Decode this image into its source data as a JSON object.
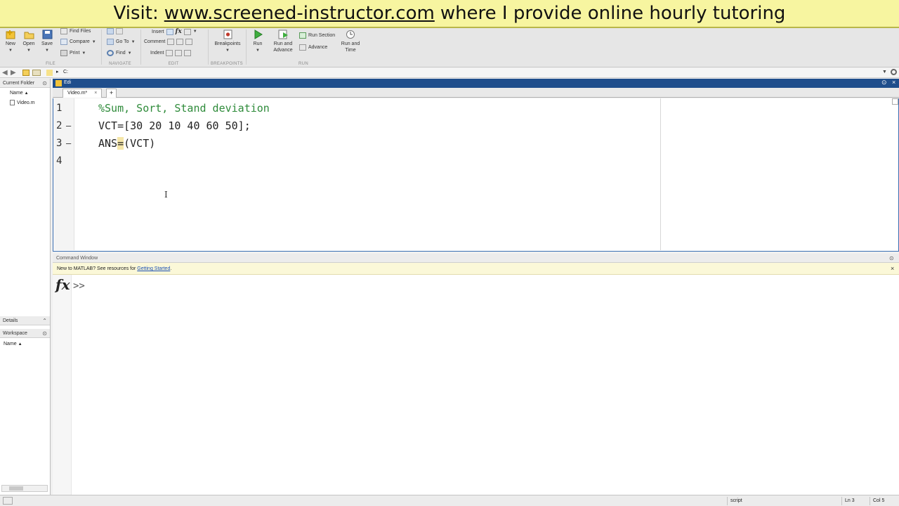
{
  "banner": {
    "prefix": "Visit:",
    "link": "www.screened-instructor.com",
    "suffix": "where I provide online hourly tutoring"
  },
  "toolstrip": {
    "file": {
      "new": "New",
      "open": "Open",
      "save": "Save",
      "find_files": "Find Files",
      "compare": "Compare",
      "print": "Print",
      "label": "FILE"
    },
    "navigate": {
      "go_to": "Go To",
      "find": "Find",
      "label": "NAVIGATE"
    },
    "edit": {
      "insert": "Insert",
      "comment": "Comment",
      "indent": "Indent",
      "fx": "fx",
      "label": "EDIT"
    },
    "breakpoints": {
      "breakpoints": "Breakpoints",
      "label": "BREAKPOINTS"
    },
    "run": {
      "run": "Run",
      "run_and_advance": "Run and Advance",
      "run_section": "Run Section",
      "advance": "Advance",
      "run_and_time": "Run and Time",
      "label": "RUN"
    }
  },
  "address": {
    "path": "C:"
  },
  "left": {
    "current_folder": "Current Folder",
    "name_col": "Name",
    "files": [
      "Video.m"
    ],
    "details": "Details",
    "workspace": "Workspace",
    "ws_name_col": "Name"
  },
  "editor": {
    "title": "Edi",
    "tab": "Video.m*",
    "add_tab": "+",
    "lines": [
      {
        "num": "1",
        "dash": "",
        "text": "%Sum, Sort, Stand deviation",
        "comment": true
      },
      {
        "num": "2",
        "dash": "—",
        "text": "VCT=[30 20 10 40 60 50];",
        "comment": false
      },
      {
        "num": "3",
        "dash": "—",
        "text_before": "ANS",
        "text_hl": "=",
        "text_after": "(VCT)",
        "comment": false
      },
      {
        "num": "4",
        "dash": "",
        "text": "",
        "comment": false
      }
    ]
  },
  "command": {
    "title": "Command Window",
    "info_text": "New to MATLAB? See resources for",
    "info_link": "Getting Started",
    "info_end": ".",
    "fx": "fx",
    "prompt": ">>"
  },
  "status": {
    "mode": "script",
    "ln": "Ln 3",
    "col": "Col 5"
  },
  "colors": {
    "editor_title": "#1f4e8c",
    "banner": "#f7f5a0",
    "comment": "#2e8b3a"
  }
}
